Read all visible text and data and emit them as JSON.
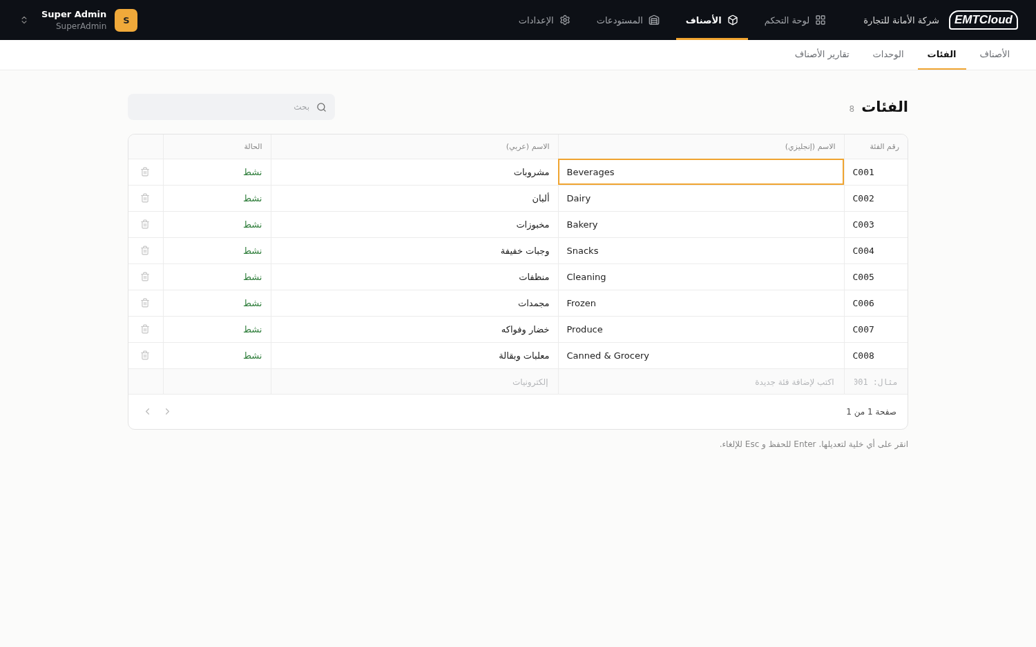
{
  "header": {
    "logo": "EMTCloud",
    "company": "شركة الأمانة للتجارة",
    "nav": [
      {
        "label": "لوحة التحكم",
        "selected": false
      },
      {
        "label": "الأصناف",
        "selected": true
      },
      {
        "label": "المستودعات",
        "selected": false
      },
      {
        "label": "الإعدادات",
        "selected": false
      }
    ],
    "user": {
      "name": "Super Admin",
      "role": "SuperAdmin",
      "initial": "S"
    }
  },
  "subnav": [
    {
      "label": "الأصناف",
      "selected": false
    },
    {
      "label": "الفئات",
      "selected": true
    },
    {
      "label": "الوحدات",
      "selected": false
    },
    {
      "label": "تقارير الأصناف",
      "selected": false
    }
  ],
  "page": {
    "title": "الفئات",
    "count": "8",
    "search": {
      "placeholder": "بحث"
    }
  },
  "table": {
    "columns": [
      "رقم الفئة",
      "الاسم (إنجليزي)",
      "الاسم (عربي)",
      "الحالة"
    ],
    "rows": [
      {
        "code": "C001",
        "name_en": "Beverages",
        "name_ar": "مشروبات",
        "status": "نشط",
        "focused": true
      },
      {
        "code": "C002",
        "name_en": "Dairy",
        "name_ar": "ألبان",
        "status": "نشط",
        "focused": false
      },
      {
        "code": "C003",
        "name_en": "Bakery",
        "name_ar": "مخبوزات",
        "status": "نشط",
        "focused": false
      },
      {
        "code": "C004",
        "name_en": "Snacks",
        "name_ar": "وجبات خفيفة",
        "status": "نشط",
        "focused": false
      },
      {
        "code": "C005",
        "name_en": "Cleaning",
        "name_ar": "منظفات",
        "status": "نشط",
        "focused": false
      },
      {
        "code": "C006",
        "name_en": "Frozen",
        "name_ar": "مجمدات",
        "status": "نشط",
        "focused": false
      },
      {
        "code": "C007",
        "name_en": "Produce",
        "name_ar": "خضار وفواكه",
        "status": "نشط",
        "focused": false
      },
      {
        "code": "C008",
        "name_en": "Canned & Grocery",
        "name_ar": "معلبات وبقالة",
        "status": "نشط",
        "focused": false
      }
    ],
    "new_row": {
      "code_placeholder": "مثال: 001",
      "name_en_placeholder": "اكتب لإضافة فئة جديدة",
      "name_ar_placeholder": "إلكترونيات"
    },
    "pagination": "صفحة 1 من 1"
  },
  "hint": "انقر على أي خلية لتعديلها. Enter للحفظ و Esc للإلغاء."
}
